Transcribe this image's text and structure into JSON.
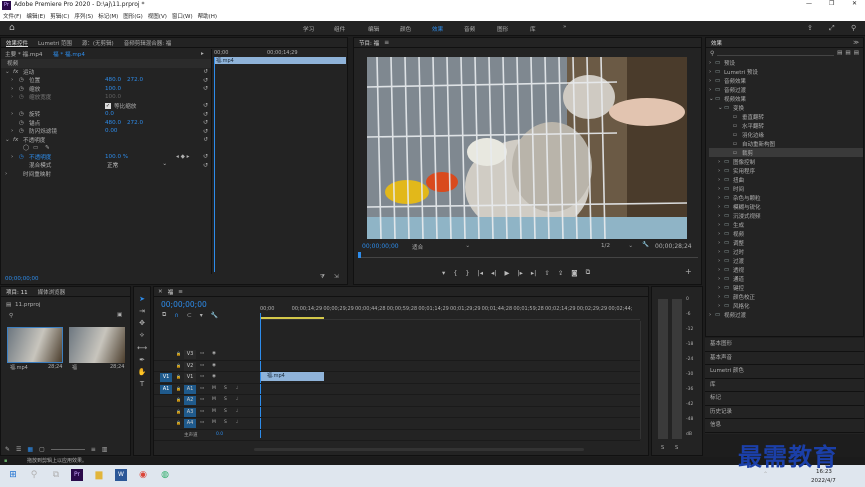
{
  "title": {
    "app_icon": "Pr",
    "text": "Adobe Premiere Pro 2020 - D:\\aj\\11.prproj *",
    "min": "—",
    "max": "❐",
    "close": "✕"
  },
  "menu": [
    "文件(F)",
    "编辑(E)",
    "剪辑(C)",
    "序列(S)",
    "标记(M)",
    "图形(G)",
    "视图(V)",
    "窗口(W)",
    "帮助(H)"
  ],
  "workspaces": [
    "学习",
    "组件",
    "编辑",
    "颜色",
    "效果",
    "音频",
    "图形",
    "库"
  ],
  "active_workspace": "效果",
  "effect_controls": {
    "tabs": [
      "效果控件",
      "Lumetri 范围",
      "源：(无剪辑)",
      "音频剪辑混合器: 福"
    ],
    "clip_master": "主要 * 福.mp4",
    "clip_seq": "福 * 福.mp4",
    "section_video": "视频",
    "motion": "运动",
    "rows": [
      {
        "label": "位置",
        "v1": "480.0",
        "v2": "272.0"
      },
      {
        "label": "缩放",
        "v1": "100.0",
        "v2": ""
      },
      {
        "label": "缩放宽度",
        "v1": "100.0",
        "v2": ""
      },
      {
        "label": "等比缩放",
        "v1": "",
        "v2": ""
      },
      {
        "label": "旋转",
        "v1": "0.0",
        "v2": ""
      },
      {
        "label": "锚点",
        "v1": "480.0",
        "v2": "272.0"
      },
      {
        "label": "防闪烁滤镜",
        "v1": "0.00",
        "v2": ""
      }
    ],
    "opacity": "不透明度",
    "opacity_row": {
      "label": "不透明度",
      "v1": "100.0 %"
    },
    "blend_row": {
      "label": "混合模式",
      "v1": "正常"
    },
    "time_remap": "时间重映射",
    "timecode": "00;00;00;00",
    "mini_ruler": {
      "t0": "00;00",
      "t1": "00;00;14;29"
    },
    "mini_clip": "福.mp4"
  },
  "program": {
    "tab": "节目: 福",
    "timecode": "00;00;00;00",
    "fit": "适合",
    "ratio": "1/2",
    "duration": "00;00;28;24"
  },
  "effects": {
    "tab": "效果",
    "items": [
      {
        "label": "预设",
        "depth": 0,
        "folder": true,
        "open": false
      },
      {
        "label": "Lumetri 预设",
        "depth": 0,
        "folder": true,
        "open": false
      },
      {
        "label": "音频效果",
        "depth": 0,
        "folder": true,
        "open": false
      },
      {
        "label": "音频过渡",
        "depth": 0,
        "folder": true,
        "open": false
      },
      {
        "label": "视频效果",
        "depth": 0,
        "folder": true,
        "open": true
      },
      {
        "label": "变换",
        "depth": 1,
        "folder": true,
        "open": true
      },
      {
        "label": "垂直翻转",
        "depth": 2,
        "folder": false
      },
      {
        "label": "水平翻转",
        "depth": 2,
        "folder": false
      },
      {
        "label": "羽化边缘",
        "depth": 2,
        "folder": false
      },
      {
        "label": "自动重新构图",
        "depth": 2,
        "folder": false
      },
      {
        "label": "裁剪",
        "depth": 2,
        "folder": false,
        "selected": true
      },
      {
        "label": "图像控制",
        "depth": 1,
        "folder": true
      },
      {
        "label": "实用程序",
        "depth": 1,
        "folder": true
      },
      {
        "label": "扭曲",
        "depth": 1,
        "folder": true
      },
      {
        "label": "时间",
        "depth": 1,
        "folder": true
      },
      {
        "label": "杂色与颗粒",
        "depth": 1,
        "folder": true
      },
      {
        "label": "模糊与锐化",
        "depth": 1,
        "folder": true
      },
      {
        "label": "沉浸式视频",
        "depth": 1,
        "folder": true
      },
      {
        "label": "生成",
        "depth": 1,
        "folder": true
      },
      {
        "label": "视频",
        "depth": 1,
        "folder": true
      },
      {
        "label": "调整",
        "depth": 1,
        "folder": true
      },
      {
        "label": "过时",
        "depth": 1,
        "folder": true
      },
      {
        "label": "过渡",
        "depth": 1,
        "folder": true
      },
      {
        "label": "透视",
        "depth": 1,
        "folder": true
      },
      {
        "label": "通道",
        "depth": 1,
        "folder": true
      },
      {
        "label": "键控",
        "depth": 1,
        "folder": true
      },
      {
        "label": "颜色校正",
        "depth": 1,
        "folder": true
      },
      {
        "label": "风格化",
        "depth": 1,
        "folder": true
      },
      {
        "label": "视频过渡",
        "depth": 0,
        "folder": true,
        "open": false
      }
    ],
    "lower_panels": [
      "基本图形",
      "基本声音",
      "Lumetri 颜色",
      "库",
      "标记",
      "历史记录",
      "信息"
    ]
  },
  "project": {
    "tabs": [
      "项目: 11",
      "媒体浏览器"
    ],
    "file": "11.prproj",
    "items": [
      {
        "name": "福.mp4",
        "dur": "28;24"
      },
      {
        "name": "福",
        "dur": "28;24"
      }
    ]
  },
  "timeline": {
    "tab": "福",
    "timecode": "00;00;00;00",
    "ticks": [
      "00;00",
      "00;00;14;29",
      "00;00;29;29",
      "00;00;44;28",
      "00;00;59;28",
      "00;01;14;29",
      "00;01;29;29",
      "00;01;44;28",
      "00;01;59;28",
      "00;02;14;29",
      "00;02;29;29",
      "00;02;44;"
    ],
    "video_tracks": [
      "V3",
      "V2",
      "V1"
    ],
    "audio_tracks": [
      "A1",
      "A2",
      "A3",
      "A4"
    ],
    "master": "主声道",
    "master_val": "0.0",
    "clip": "福.mp4",
    "target_v": "V1",
    "target_a": "A1"
  },
  "meter": {
    "labels": [
      "0",
      "-6",
      "-12",
      "-18",
      "-24",
      "-30",
      "-36",
      "-42",
      "-48",
      "dB"
    ],
    "s": [
      "S",
      "S"
    ]
  },
  "status": "单击以选择，或单击空白处并拖动以进行框选。使用 Shift、Alt 和 Ctrl 获得其他选项。",
  "status_short": "拖放到剪辑上以应用效果。",
  "taskbar": {
    "time": "16:23",
    "date": "2022/4/7"
  },
  "watermark": "最需教育"
}
